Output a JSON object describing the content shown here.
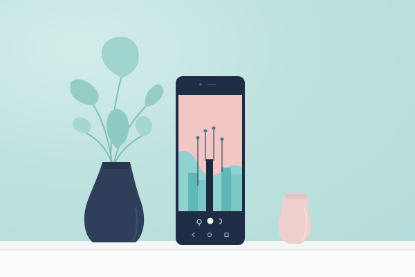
{
  "scene": {
    "description": "",
    "colors": {
      "wall": "#bfe2df",
      "shelf": "#f7f9f9",
      "phone_body": "#1e2d45",
      "phone_screen_bg": "#f2c6c4",
      "chart_teal": "#5fb8b6",
      "chart_teal_light": "#8fd2cf",
      "chart_dark": "#1c2a40",
      "vase_dark": "#2f3f5b",
      "vase_pink": "#f0cfcf",
      "leaf": "#9fd3cd"
    }
  },
  "phone": {
    "nav": {
      "back_icon": "chevron-left-icon",
      "home_icon": "circle-icon",
      "recents_icon": "square-icon"
    },
    "toolbar": {
      "left_icon": "paint-icon",
      "center_icon": "record-icon",
      "right_icon": "refresh-icon"
    }
  }
}
